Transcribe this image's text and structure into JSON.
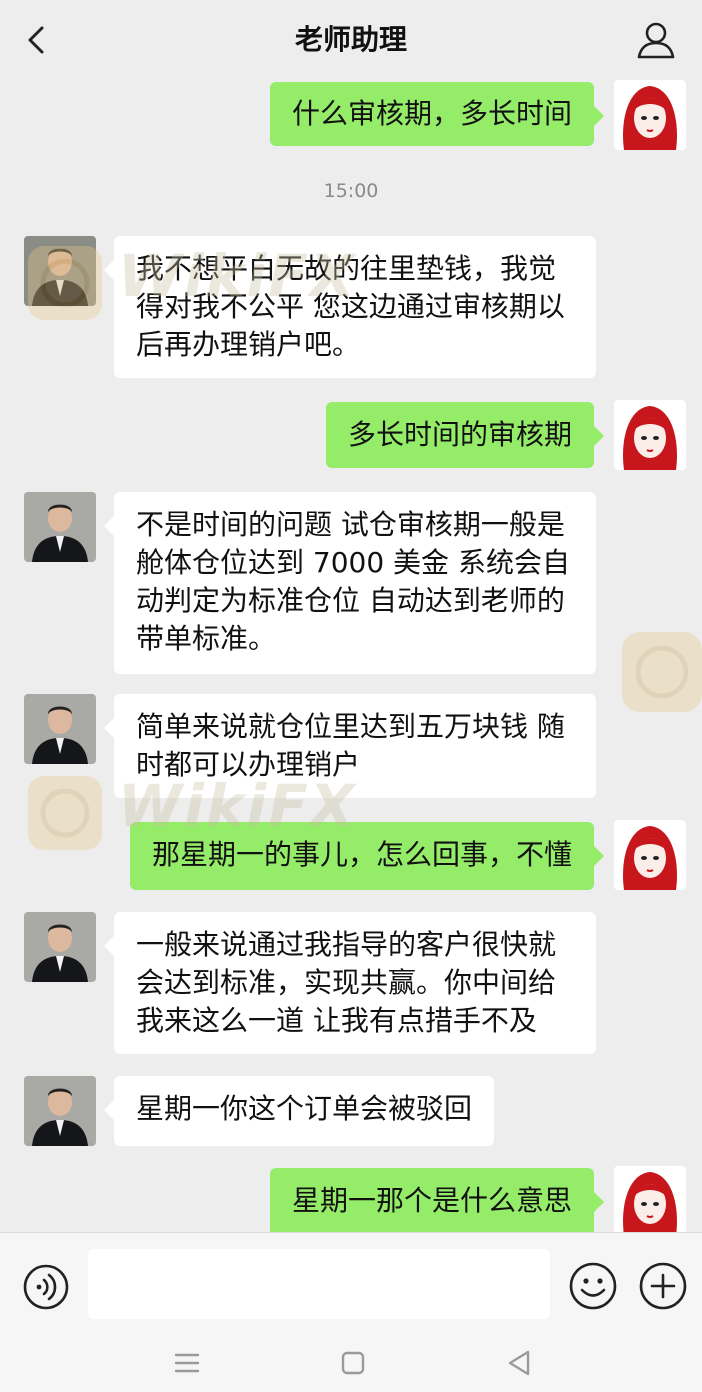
{
  "header": {
    "title": "老师助理"
  },
  "chat": {
    "timestamp": "15:00",
    "messages": [
      {
        "text": "什么审核期，多长时间"
      },
      {
        "text": "我不想平白无故的往里垫钱，我觉得对我不公平 您这边通过审核期以后再办理销户吧。"
      },
      {
        "text": "多长时间的审核期"
      },
      {
        "text": "不是时间的问题 试仓审核期一般是舱体仓位达到 7000 美金 系统会自动判定为标准仓位 自动达到老师的带单标准。"
      },
      {
        "text": "简单来说就仓位里达到五万块钱 随时都可以办理销户"
      },
      {
        "text": "那星期一的事儿，怎么回事，不懂"
      },
      {
        "text": "一般来说通过我指导的客户很快就会达到标准，实现共赢。你中间给我来这么一道 让我有点措手不及"
      },
      {
        "text": "星期一你这个订单会被驳回"
      },
      {
        "text": "星期一那个是什么意思"
      }
    ]
  },
  "watermark": {
    "text": "WikiFX"
  },
  "colors": {
    "outgoing_bubble": "#95ec69",
    "incoming_bubble": "#ffffff",
    "background": "#ededed"
  }
}
